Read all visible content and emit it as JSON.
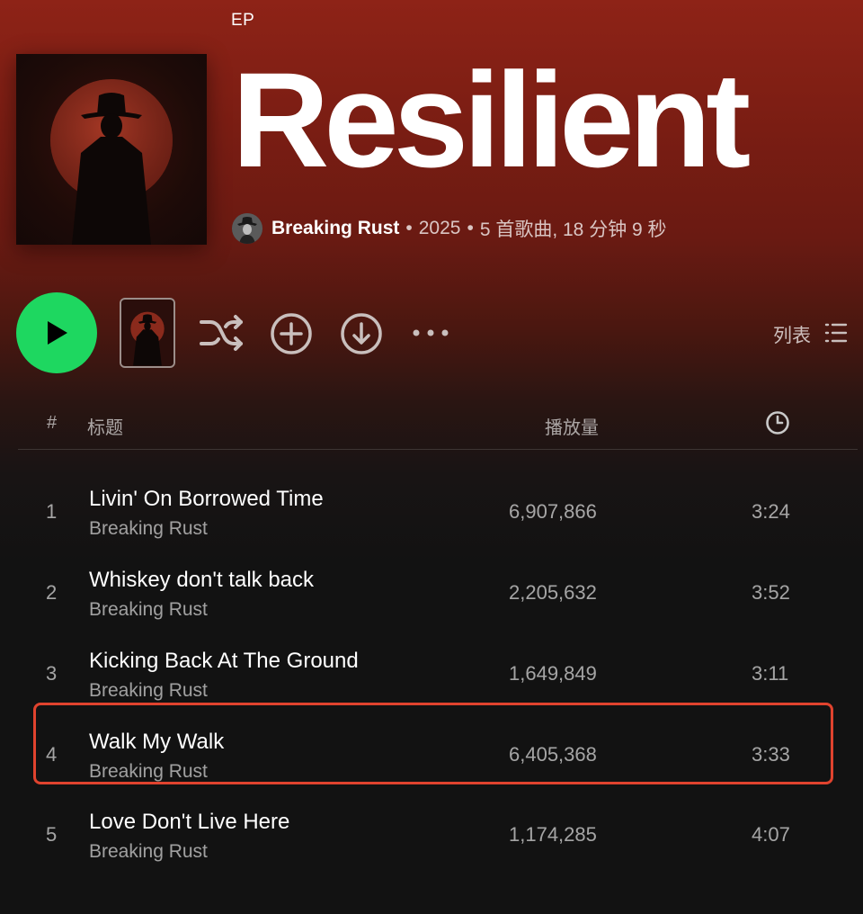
{
  "header": {
    "type_label": "EP",
    "title": "Resilient",
    "artist": "Breaking Rust",
    "separator": "•",
    "year": "2025",
    "summary": "5 首歌曲, 18 分钟 9 秒"
  },
  "actions": {
    "view_label": "列表",
    "more_label": "···"
  },
  "table": {
    "num_header": "#",
    "title_header": "标题",
    "plays_header": "播放量"
  },
  "tracks": [
    {
      "num": "1",
      "title": "Livin' On Borrowed Time",
      "artist": "Breaking Rust",
      "plays": "6,907,866",
      "duration": "3:24"
    },
    {
      "num": "2",
      "title": "Whiskey don't talk back",
      "artist": "Breaking Rust",
      "plays": "2,205,632",
      "duration": "3:52"
    },
    {
      "num": "3",
      "title": "Kicking Back At The Ground",
      "artist": "Breaking Rust",
      "plays": "1,649,849",
      "duration": "3:11"
    },
    {
      "num": "4",
      "title": "Walk My Walk",
      "artist": "Breaking Rust",
      "plays": "6,405,368",
      "duration": "3:33"
    },
    {
      "num": "5",
      "title": "Love Don't Live Here",
      "artist": "Breaking Rust",
      "plays": "1,174,285",
      "duration": "4:07"
    }
  ],
  "colors": {
    "accent_green": "#1ed760",
    "highlight_red": "#e0432e",
    "header_red": "#8e2317",
    "background": "#121212"
  }
}
